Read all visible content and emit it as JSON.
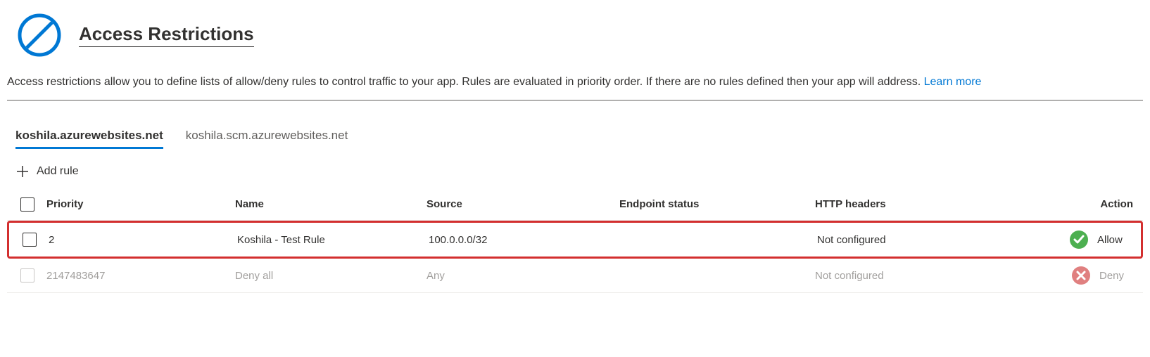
{
  "header": {
    "title": "Access Restrictions"
  },
  "description": {
    "text": "Access restrictions allow you to define lists of allow/deny rules to control traffic to your app. Rules are evaluated in priority order. If there are no rules defined then your app will address. ",
    "link_text": "Learn more"
  },
  "tabs": [
    {
      "label": "koshila.azurewebsites.net",
      "active": true
    },
    {
      "label": "koshila.scm.azurewebsites.net",
      "active": false
    }
  ],
  "toolbar": {
    "add_rule_label": "Add rule"
  },
  "table": {
    "headers": {
      "priority": "Priority",
      "name": "Name",
      "source": "Source",
      "endpoint": "Endpoint status",
      "http": "HTTP headers",
      "action": "Action"
    },
    "rows": [
      {
        "priority": "2",
        "name": "Koshila - Test Rule",
        "source": "100.0.0.0/32",
        "endpoint": "",
        "http": "Not configured",
        "action": "Allow",
        "highlighted": true,
        "dim": false,
        "status": "allow"
      },
      {
        "priority": "2147483647",
        "name": "Deny all",
        "source": "Any",
        "endpoint": "",
        "http": "Not configured",
        "action": "Deny",
        "highlighted": false,
        "dim": true,
        "status": "deny"
      }
    ]
  }
}
